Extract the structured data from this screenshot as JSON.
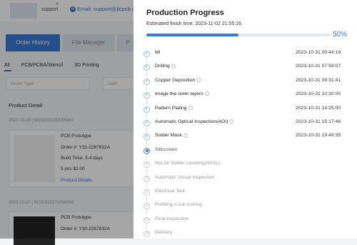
{
  "background": {
    "header": {
      "support": "support",
      "support_mark": "®",
      "email": "Email: support@jlcpcb.com"
    },
    "tabs": [
      "Order History",
      "File Manager",
      "P"
    ],
    "subtabs": [
      "All",
      "PCB/PCBA/Stencil",
      "3D Printing"
    ],
    "filters": {
      "order_type": "Order Type",
      "date": "Date"
    },
    "product_detail": "Product Detail",
    "orders": [
      {
        "date_id": "2023-10-29  |  W202310292055467",
        "product": "PCB Prototype",
        "order_no": "Order #:    Y31-2287832A",
        "build_time": "Build Time: 3-4 days",
        "qty_price": "5 pcs    $2.00",
        "link": "Product Details"
      },
      {
        "date_id": "2023-10-27  |  W202310271058368",
        "product": "PCB Prototype",
        "order_no": "Order #:    Y30-2287832A"
      }
    ]
  },
  "drawer": {
    "title": "Production Progress",
    "estimated": "Estimated finish time: 2023-11-02 21:55:16",
    "progress_percent": 50,
    "progress_label": "50%",
    "steps": [
      {
        "name": "MI",
        "time": "2023-10-31 00:44:19",
        "status": "done",
        "info": false
      },
      {
        "name": "Drilling",
        "time": "2023-10-31 07:59:07",
        "status": "done",
        "info": true
      },
      {
        "name": "Copper Deposition",
        "time": "2023-10-31 09:31:41",
        "status": "done",
        "info": true
      },
      {
        "name": "Image the outer layers",
        "time": "2023-10-31 10:32:00",
        "status": "done",
        "info": true
      },
      {
        "name": "Pattern Plating",
        "time": "2023-10-31 14:25:00",
        "status": "done",
        "info": true
      },
      {
        "name": "Automatic Optical Inspection(AOI)",
        "time": "2023-10-31 15:17:46",
        "status": "done",
        "info": true
      },
      {
        "name": "Solder Mask",
        "time": "2023-10-31 19:49:35",
        "status": "done",
        "info": true
      },
      {
        "name": "Silkscreen",
        "time": "",
        "status": "current",
        "info": false,
        "num": "8"
      },
      {
        "name": "Hot Air Solder Leveling(HASL)",
        "time": "",
        "status": "pending",
        "info": false,
        "num": "9"
      },
      {
        "name": "Automatic Visual Inspection",
        "time": "",
        "status": "pending",
        "info": false,
        "num": "10"
      },
      {
        "name": "Electrical Test",
        "time": "",
        "status": "pending",
        "info": false,
        "num": "11"
      },
      {
        "name": "Profiling,V-cut scoring",
        "time": "",
        "status": "pending",
        "info": false,
        "num": "12"
      },
      {
        "name": "Final inspection",
        "time": "",
        "status": "pending",
        "info": false,
        "num": "13"
      },
      {
        "name": "Delivery",
        "time": "",
        "status": "pending",
        "info": false,
        "num": "14"
      }
    ]
  },
  "colors": {
    "accent": "#3a7ad5"
  },
  "icons": {
    "done": "check-circle-icon",
    "info": "info-icon",
    "email": "email-icon"
  }
}
